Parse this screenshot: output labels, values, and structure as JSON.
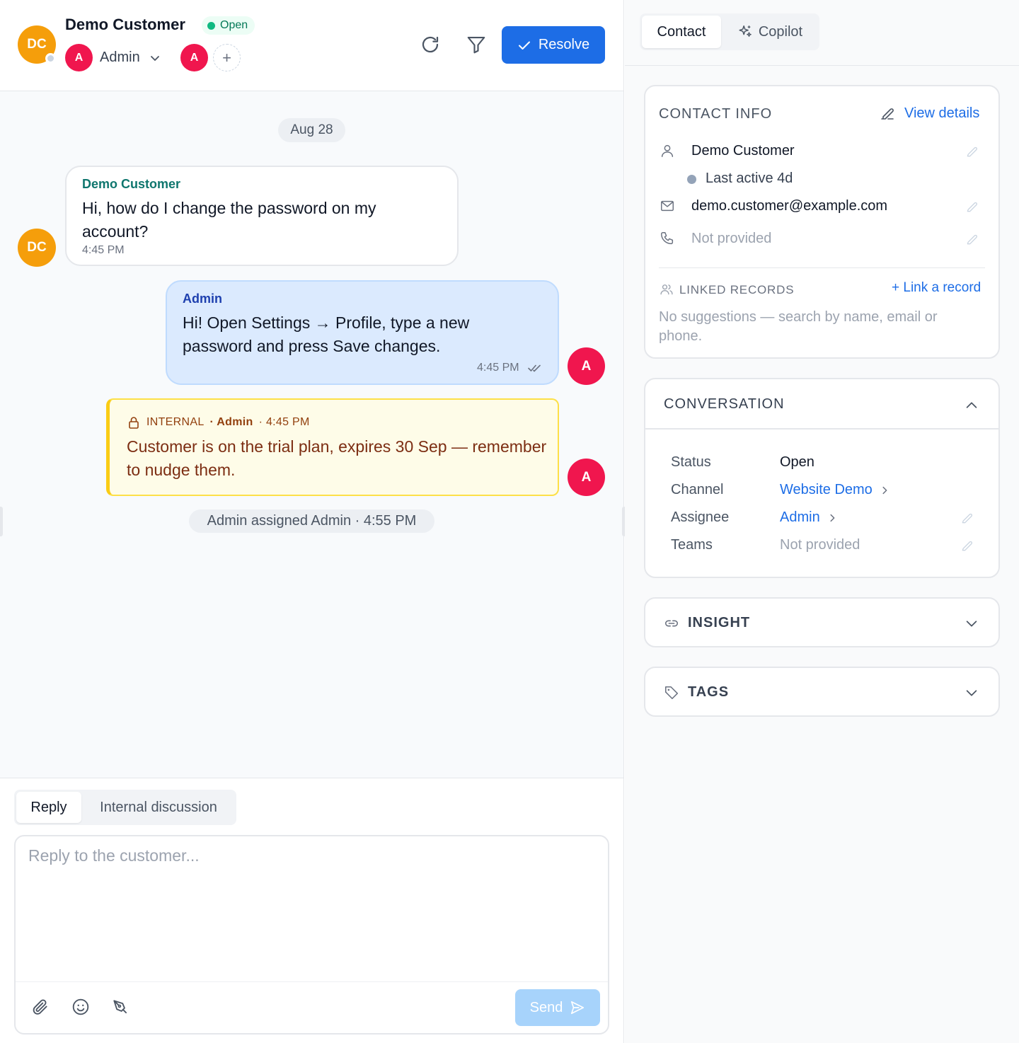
{
  "header": {
    "customer_initials": "DC",
    "customer_name": "Demo Customer",
    "status": "Open",
    "assignee_initial": "A",
    "assignee_name": "Admin",
    "participant_initial": "A",
    "add_participant": "+",
    "resolve_label": "Resolve"
  },
  "thread": {
    "date_divider": "Aug 28",
    "messages": [
      {
        "sender": "Demo Customer",
        "initials": "DC",
        "text": "Hi, how do I change the password on my account?",
        "time": "4:45 PM"
      },
      {
        "sender": "Admin",
        "initials": "A",
        "text": "Hi! Open Settings → Profile, type a new password and press Save changes.",
        "time": "4:45 PM"
      }
    ],
    "internal_note": {
      "label": "INTERNAL",
      "author": "· Admin",
      "time": "· 4:45 PM",
      "initials": "A",
      "text": "Customer is on the trial plan, expires 30 Sep — remember to nudge them."
    },
    "event": "Admin assigned Admin · 4:55 PM"
  },
  "composer": {
    "tabs": [
      "Reply",
      "Internal discussion"
    ],
    "active_tab": "Reply",
    "placeholder": "Reply to the customer...",
    "value": "",
    "send_label": "Send"
  },
  "sidebar": {
    "tabs": [
      "Contact",
      "Copilot"
    ],
    "active_tab": "Contact",
    "contact_info": {
      "title": "CONTACT INFO",
      "view_details": "View details",
      "name": "Demo Customer",
      "last_active": "Last active 4d",
      "email": "demo.customer@example.com",
      "phone": "Not provided",
      "linked_records_title": "LINKED RECORDS",
      "link_record": "+ Link a record",
      "no_suggestions": "No suggestions — search by name, email or phone."
    },
    "conversation": {
      "title": "CONVERSATION",
      "rows": [
        {
          "key": "Status",
          "value": "Open"
        },
        {
          "key": "Channel",
          "value": "Website Demo"
        },
        {
          "key": "Assignee",
          "value": "Admin"
        },
        {
          "key": "Teams",
          "value": "Not provided"
        }
      ]
    },
    "insight": {
      "title": "INSIGHT"
    },
    "tags": {
      "title": "TAGS"
    }
  },
  "colors": {
    "brand_blue": "#1d6de6",
    "customer_avatar": "#f59e0b",
    "admin_avatar": "#f0164e",
    "status_green": "#10b981",
    "admin_bubble": "#dbeafe",
    "note_bubble": "#fefce8",
    "note_border": "#facc15",
    "send_disabled": "#a7d3fb"
  },
  "icons": {
    "refresh": "refresh-icon",
    "filter": "filter-icon",
    "resolve": "check-icon",
    "read_receipt": "double-check-icon",
    "lock": "lock-icon",
    "attach": "paperclip-icon",
    "emoji": "emoji-icon",
    "signature": "signature-pen-icon",
    "send": "send-icon",
    "copilot": "sparkle-icon",
    "edit": "pencil-icon",
    "person": "user-icon",
    "email": "mail-icon",
    "phone": "phone-icon",
    "linked_records": "users-icon",
    "insight": "link-icon",
    "tags": "tag-icon",
    "collapse": "chevron-up-icon",
    "expand": "chevron-down-icon",
    "go": "chevron-right-icon"
  }
}
